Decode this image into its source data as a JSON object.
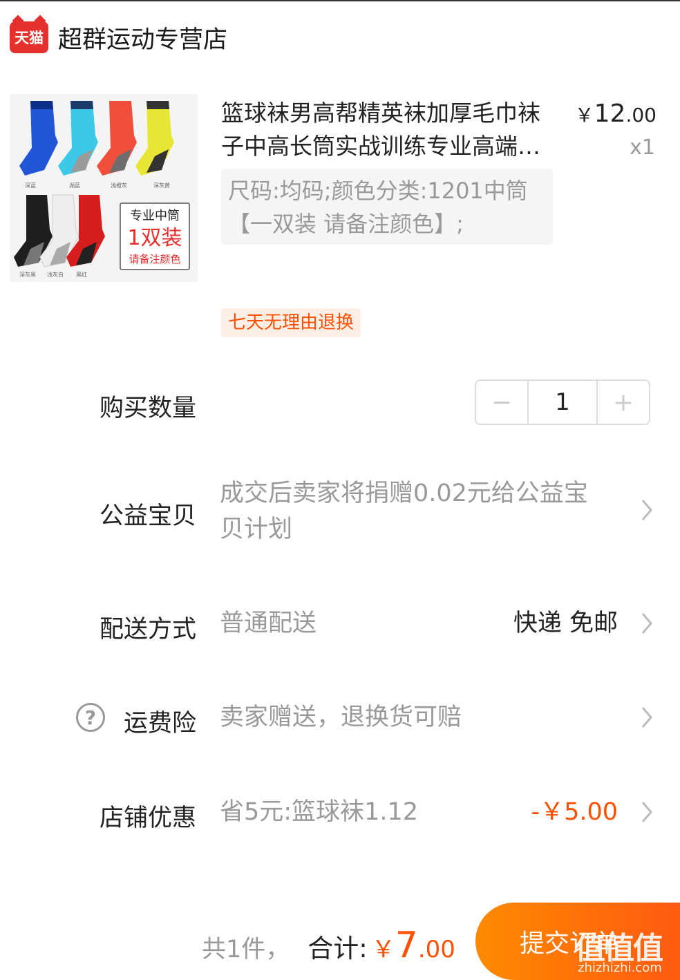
{
  "shop": {
    "logo_text": "天猫",
    "name": "超群运动专营店"
  },
  "product": {
    "title": "篮球袜男高帮精英袜加厚毛巾袜子中高长筒实战训练专业高端运动袜",
    "price_currency": "￥",
    "price_int": "12",
    "price_dec": ".00",
    "quantity": "x1",
    "sku": "尺码:均码;颜色分类:1201中筒【一双装 请备注颜色】;",
    "tag": "七天无理由退换",
    "image": {
      "badge_line1": "专业中筒",
      "badge_line2": "1双装",
      "badge_line3": "请备注颜色",
      "colors": [
        "深蓝",
        "湖蓝",
        "浅橙灰",
        "深灰黄",
        "深灰黑",
        "浅灰白",
        "黑红"
      ],
      "sock_colors": [
        "#2156d9",
        "#3cc8e8",
        "#f04f3c",
        "#e8e634",
        "#1e1e1e",
        "#e8e8e8",
        "#d61e1e"
      ]
    }
  },
  "quantity_row": {
    "label": "购买数量",
    "minus": "−",
    "value": "1",
    "plus": "+"
  },
  "charity_row": {
    "label": "公益宝贝",
    "value": "成交后卖家将捐赠0.02元给公益宝贝计划"
  },
  "delivery_row": {
    "label": "配送方式",
    "value": "普通配送",
    "right": "快递 免邮"
  },
  "insurance_row": {
    "icon": "?",
    "label": "运费险",
    "value": "卖家赠送，退换货可赔"
  },
  "discount_row": {
    "label": "店铺优惠",
    "value": "省5元:篮球袜1.12",
    "right": "-￥5.00"
  },
  "footer": {
    "count": "共1件，",
    "sum_label": "合计:",
    "sum_currency": "￥",
    "sum_int": "7",
    "sum_dec": ".00",
    "submit": "提交订单",
    "watermark": "值值值",
    "watermark_sub": "zhizhizhi.com"
  },
  "colors": {
    "accent": "#ff5000",
    "tmall_red": "#e4312e",
    "muted": "#999999"
  }
}
